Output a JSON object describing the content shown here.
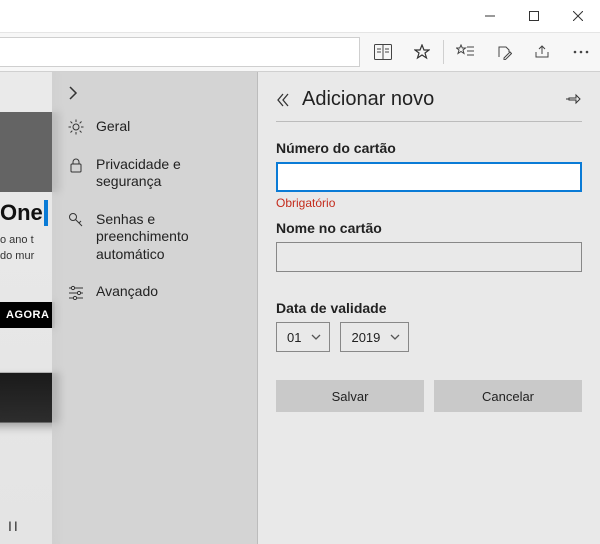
{
  "titlebar": {
    "minimize": "–",
    "maximize": "☐",
    "close": "✕"
  },
  "background_page": {
    "badge": "One",
    "line1": "o ano t",
    "line2": "do mur",
    "cta": "AGORA",
    "pause": "II"
  },
  "settings_sidebar": {
    "items": [
      {
        "label": "Geral"
      },
      {
        "label": "Privacidade e segurança"
      },
      {
        "label": "Senhas e preenchimento automático"
      },
      {
        "label": "Avançado"
      }
    ]
  },
  "panel": {
    "title": "Adicionar novo",
    "card_number_label": "Número do cartão",
    "card_number_value": "",
    "card_number_error": "Obrigatório",
    "name_label": "Nome no cartão",
    "name_value": "",
    "expiry_label": "Data de validade",
    "expiry_month": "01",
    "expiry_year": "2019",
    "save": "Salvar",
    "cancel": "Cancelar"
  }
}
